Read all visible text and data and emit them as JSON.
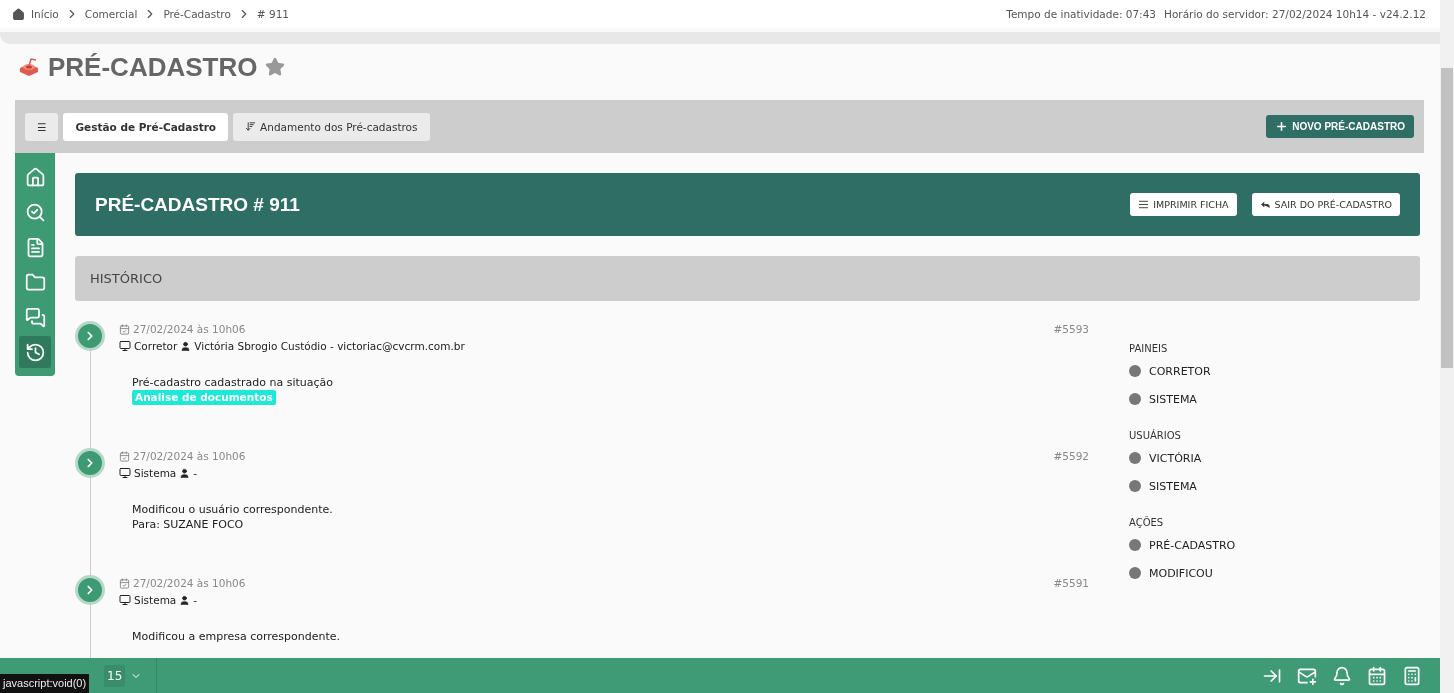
{
  "breadcrumb": [
    "Início",
    "Comercial",
    "Pré-Cadastro",
    "# 911"
  ],
  "status": {
    "idle": "Tempo de inatividade: 07:43",
    "server": "Horário do servidor: 27/02/2024 10h14 - v24.2.12"
  },
  "page_title": "PRÉ-CADASTRO",
  "toolbar": {
    "menu_glyph": "☰",
    "tabs": [
      {
        "label": "Gestão de Pré-Cadastro",
        "selected": true,
        "kind": "plain"
      },
      {
        "label": "Andamento dos Pré-cadastros",
        "selected": false,
        "kind": "sort"
      }
    ],
    "action": "NOVO PRÉ-CADASTRO"
  },
  "sidebar": [
    {
      "kind": "home",
      "selected": false
    },
    {
      "kind": "search",
      "selected": false
    },
    {
      "kind": "file",
      "selected": false
    },
    {
      "kind": "folder",
      "selected": false
    },
    {
      "kind": "chat",
      "selected": false
    },
    {
      "kind": "history",
      "selected": true
    }
  ],
  "header": {
    "title": "PRÉ-CADASTRO # 911",
    "buttons": [
      {
        "kind": "print",
        "label": "IMPRIMIR FICHA"
      },
      {
        "kind": "exit",
        "label": "SAIR DO PRÉ-CADASTRO"
      }
    ]
  },
  "section_title": "HISTÓRICO",
  "events": [
    {
      "date": "27/02/2024 às 10h06",
      "panel": "Corretor",
      "user": "Victória Sbrogio Custódio - victoriac@cvcrm.com.br",
      "id": "#5593",
      "lines": [
        "Pré-cadastro cadastrado na situação"
      ],
      "tag": "Analise de documentos"
    },
    {
      "date": "27/02/2024 às 10h06",
      "panel": "Sistema",
      "user": "-",
      "id": "#5592",
      "lines": [
        "Modificou o usuário correspondente.",
        "Para: SUZANE FOCO"
      ]
    },
    {
      "date": "27/02/2024 às 10h06",
      "panel": "Sistema",
      "user": "-",
      "id": "#5591",
      "lines": [
        "Modificou a empresa correspondente."
      ]
    }
  ],
  "filters": [
    {
      "title": "PAINEIS",
      "items": [
        "CORRETOR",
        "SISTEMA"
      ]
    },
    {
      "title": "USUÁRIOS",
      "items": [
        "VICTÓRIA",
        "SISTEMA"
      ]
    },
    {
      "title": "AÇÕES",
      "items": [
        "PRÉ-CADASTRO",
        "MODIFICOU"
      ]
    }
  ],
  "bottom_bar": {
    "count": "15",
    "tooltip": "javascript:void(0)"
  }
}
